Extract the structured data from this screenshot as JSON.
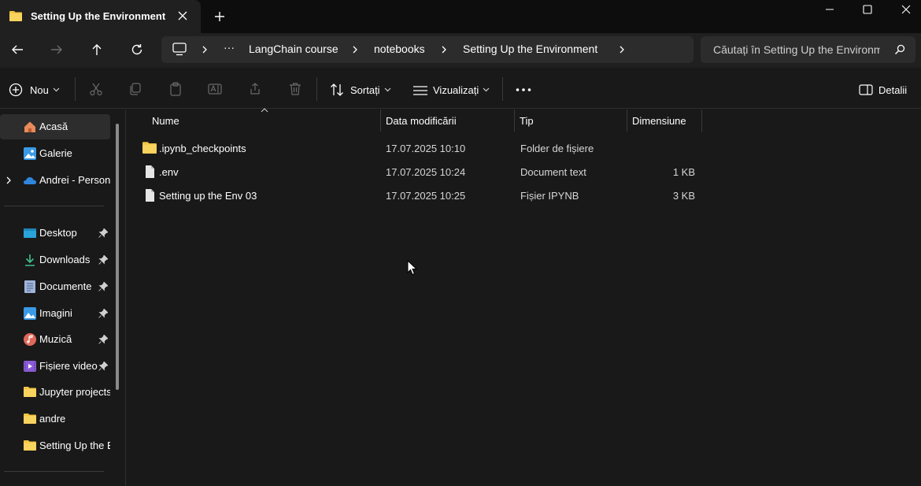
{
  "window": {
    "tab_title": "Setting Up the Environment"
  },
  "address_bar": {
    "ellipsis": "···",
    "crumbs": [
      "LangChain course",
      "notebooks",
      "Setting Up the Environment"
    ]
  },
  "search": {
    "placeholder": "Căutați în Setting Up the Environment"
  },
  "commands": {
    "new_label": "Nou",
    "sort_label": "Sortați",
    "view_label": "Vizualizați",
    "details_label": "Detalii"
  },
  "sidebar": {
    "items": [
      {
        "label": "Acasă",
        "icon": "home-icon"
      },
      {
        "label": "Galerie",
        "icon": "gallery-icon"
      },
      {
        "label": "Andrei - Personal",
        "icon": "onedrive-cloud-icon"
      },
      {
        "label": "Desktop",
        "icon": "desktop-icon",
        "pinned": true
      },
      {
        "label": "Downloads",
        "icon": "download-icon",
        "pinned": true
      },
      {
        "label": "Documente",
        "icon": "document-icon",
        "pinned": true
      },
      {
        "label": "Imagini",
        "icon": "pictures-icon",
        "pinned": true
      },
      {
        "label": "Muzică",
        "icon": "music-icon",
        "pinned": true
      },
      {
        "label": "Fișiere video",
        "icon": "video-icon",
        "pinned": true
      },
      {
        "label": "Jupyter projects",
        "icon": "folder-icon"
      },
      {
        "label": "andre",
        "icon": "folder-icon"
      },
      {
        "label": "Setting Up the Environment",
        "icon": "folder-icon"
      }
    ]
  },
  "columns": {
    "name": "Nume",
    "date": "Data modificării",
    "type": "Tip",
    "size": "Dimensiune"
  },
  "files": [
    {
      "name": ".ipynb_checkpoints",
      "date": "17.07.2025 10:10",
      "type": "Folder de fișiere",
      "size": "",
      "icon": "folder-icon"
    },
    {
      "name": ".env",
      "date": "17.07.2025 10:24",
      "type": "Document text",
      "size": "1 KB",
      "icon": "file-icon"
    },
    {
      "name": "Setting up the Env 03",
      "date": "17.07.2025 10:25",
      "type": "Fișier IPYNB",
      "size": "3 KB",
      "icon": "file-icon"
    }
  ],
  "colors": {
    "folder": "#f4c542",
    "background": "#191919",
    "chrome": "#202020"
  }
}
